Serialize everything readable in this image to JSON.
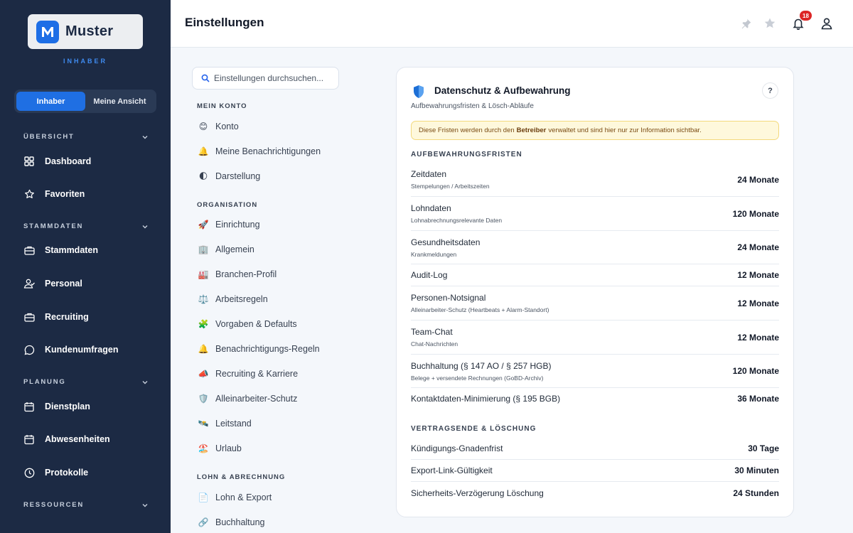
{
  "brand": {
    "name": "Muster",
    "role": "INHABER"
  },
  "view_toggle": {
    "options": [
      "Inhaber",
      "Meine Ansicht"
    ],
    "active": "Inhaber"
  },
  "sidebar": {
    "sections": [
      {
        "title": "ÜBERSICHT",
        "items": [
          "Dashboard",
          "Favoriten"
        ]
      },
      {
        "title": "STAMMDATEN",
        "items": [
          "Stammdaten",
          "Personal",
          "Recruiting",
          "Kundenumfragen"
        ]
      },
      {
        "title": "PLANUNG",
        "items": [
          "Dienstplan",
          "Abwesenheiten",
          "Protokolle"
        ]
      },
      {
        "title": "RESSOURCEN",
        "items": []
      }
    ]
  },
  "header": {
    "title": "Einstellungen",
    "notification_count": "18"
  },
  "settings_nav": {
    "search_placeholder": "Einstellungen durchsuchen...",
    "groups": [
      {
        "title": "MEIN KONTO",
        "items": [
          {
            "emoji": "😊",
            "label": "Konto"
          },
          {
            "emoji": "🔔",
            "label": "Meine Benachrichtigungen"
          },
          {
            "emoji": "🌓",
            "label": "Darstellung"
          }
        ]
      },
      {
        "title": "ORGANISATION",
        "items": [
          {
            "emoji": "🚀",
            "label": "Einrichtung"
          },
          {
            "emoji": "🏢",
            "label": "Allgemein"
          },
          {
            "emoji": "🏭",
            "label": "Branchen-Profil"
          },
          {
            "emoji": "⚖️",
            "label": "Arbeitsregeln"
          },
          {
            "emoji": "🧩",
            "label": "Vorgaben & Defaults"
          },
          {
            "emoji": "🔔",
            "label": "Benachrichtigungs-Regeln"
          },
          {
            "emoji": "📣",
            "label": "Recruiting & Karriere"
          },
          {
            "emoji": "🛡️",
            "label": "Alleinarbeiter-Schutz"
          },
          {
            "emoji": "🛰️",
            "label": "Leitstand"
          },
          {
            "emoji": "🏖️",
            "label": "Urlaub"
          }
        ]
      },
      {
        "title": "LOHN & ABRECHNUNG",
        "items": [
          {
            "emoji": "📄",
            "label": "Lohn & Export"
          },
          {
            "emoji": "🔗",
            "label": "Buchhaltung"
          }
        ]
      }
    ]
  },
  "card": {
    "title": "Datenschutz & Aufbewahrung",
    "subtitle": "Aufbewahrungsfristen & Lösch-Abläufe",
    "help": "?",
    "notice": {
      "before": "Diese Fristen werden durch den",
      "bold": "Betreiber",
      "after": "verwaltet und sind hier nur zur Information sichtbar."
    },
    "retention_title": "AUFBEWAHRUNGSFRISTEN",
    "retention": [
      {
        "label": "Zeitdaten",
        "desc": "Stempelungen / Arbeitszeiten",
        "value": "24 Monate"
      },
      {
        "label": "Lohndaten",
        "desc": "Lohnabrechnungsrelevante Daten",
        "value": "120 Monate"
      },
      {
        "label": "Gesundheitsdaten",
        "desc": "Krankmeldungen",
        "value": "24 Monate"
      },
      {
        "label": "Audit-Log",
        "desc": "",
        "value": "12 Monate"
      },
      {
        "label": "Personen-Notsignal",
        "desc": "Alleinarbeiter-Schutz (Heartbeats + Alarm-Standort)",
        "value": "12 Monate"
      },
      {
        "label": "Team-Chat",
        "desc": "Chat-Nachrichten",
        "value": "12 Monate"
      },
      {
        "label": "Buchhaltung (§ 147 AO / § 257 HGB)",
        "desc": "Belege + versendete Rechnungen (GoBD-Archiv)",
        "value": "120 Monate"
      },
      {
        "label": "Kontaktdaten-Minimierung (§ 195 BGB)",
        "desc": "",
        "value": "36 Monate"
      }
    ],
    "termination_title": "VERTRAGSENDE & LÖSCHUNG",
    "termination": [
      {
        "label": "Kündigungs-Gnadenfrist",
        "value": "30 Tage"
      },
      {
        "label": "Export-Link-Gültigkeit",
        "value": "30 Minuten"
      },
      {
        "label": "Sicherheits-Verzögerung Löschung",
        "value": "24 Stunden"
      }
    ]
  },
  "colors": {
    "sidebar_bg": "#1c2a44",
    "accent": "#1f6fe3",
    "notice_bg": "#fef8dc",
    "badge": "#dc2626"
  }
}
